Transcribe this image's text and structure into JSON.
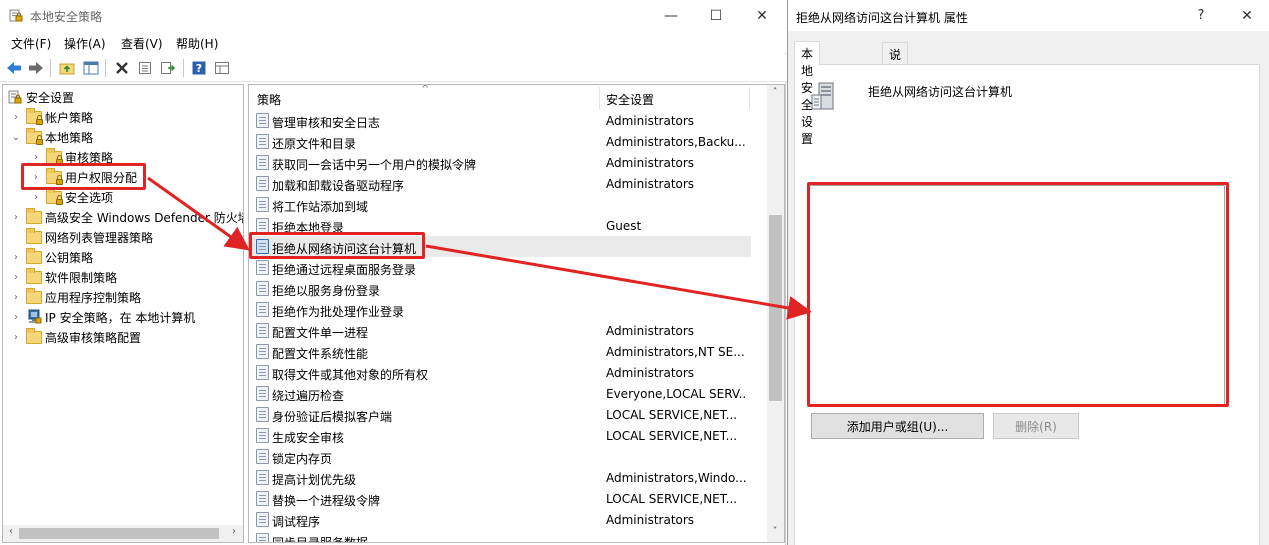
{
  "main_window": {
    "title": "本地安全策略",
    "controls": {
      "minimize": "—",
      "maximize": "☐",
      "close": "✕"
    }
  },
  "menu": [
    "文件(F)",
    "操作(A)",
    "查看(V)",
    "帮助(H)"
  ],
  "toolbar": {
    "icons": [
      "back-icon",
      "forward-icon",
      "up-folder-icon",
      "show-hide-tree-icon",
      "delete-icon",
      "properties-icon",
      "export-list-icon",
      "help-icon",
      "view-icon"
    ]
  },
  "tree": {
    "nodes": [
      {
        "label": "安全设置",
        "level": 0,
        "expander": "",
        "icon": "security-settings-icon"
      },
      {
        "label": "帐户策略",
        "level": 1,
        "expander": "›",
        "icon": "folder-lock-icon"
      },
      {
        "label": "本地策略",
        "level": 1,
        "expander": "⌄",
        "icon": "folder-lock-icon"
      },
      {
        "label": "审核策略",
        "level": 2,
        "expander": "›",
        "icon": "folder-lock-icon"
      },
      {
        "label": "用户权限分配",
        "level": 2,
        "expander": "›",
        "icon": "folder-lock-icon"
      },
      {
        "label": "安全选项",
        "level": 2,
        "expander": "›",
        "icon": "folder-lock-icon"
      },
      {
        "label": "高级安全 Windows Defender 防火墙",
        "level": 1,
        "expander": "›",
        "icon": "folder-icon"
      },
      {
        "label": "网络列表管理器策略",
        "level": 1,
        "expander": "",
        "icon": "folder-icon"
      },
      {
        "label": "公钥策略",
        "level": 1,
        "expander": "›",
        "icon": "folder-icon"
      },
      {
        "label": "软件限制策略",
        "level": 1,
        "expander": "›",
        "icon": "folder-icon"
      },
      {
        "label": "应用程序控制策略",
        "level": 1,
        "expander": "›",
        "icon": "folder-icon"
      },
      {
        "label": "IP 安全策略，在 本地计算机",
        "level": 1,
        "expander": "›",
        "icon": "ip-security-icon"
      },
      {
        "label": "高级审核策略配置",
        "level": 1,
        "expander": "›",
        "icon": "folder-icon"
      }
    ]
  },
  "list": {
    "columns": {
      "policy": "策略",
      "setting": "安全设置"
    },
    "rows": [
      {
        "name": "管理审核和安全日志",
        "value": "Administrators"
      },
      {
        "name": "还原文件和目录",
        "value": "Administrators,Backu..."
      },
      {
        "name": "获取同一会话中另一个用户的模拟令牌",
        "value": "Administrators"
      },
      {
        "name": "加载和卸载设备驱动程序",
        "value": "Administrators"
      },
      {
        "name": "将工作站添加到域",
        "value": ""
      },
      {
        "name": "拒绝本地登录",
        "value": "Guest"
      },
      {
        "name": "拒绝从网络访问这台计算机",
        "value": ""
      },
      {
        "name": "拒绝通过远程桌面服务登录",
        "value": ""
      },
      {
        "name": "拒绝以服务身份登录",
        "value": ""
      },
      {
        "name": "拒绝作为批处理作业登录",
        "value": ""
      },
      {
        "name": "配置文件单一进程",
        "value": "Administrators"
      },
      {
        "name": "配置文件系统性能",
        "value": "Administrators,NT SE..."
      },
      {
        "name": "取得文件或其他对象的所有权",
        "value": "Administrators"
      },
      {
        "name": "绕过遍历检查",
        "value": "Everyone,LOCAL SERV..."
      },
      {
        "name": "身份验证后模拟客户端",
        "value": "LOCAL SERVICE,NET..."
      },
      {
        "name": "生成安全审核",
        "value": "LOCAL SERVICE,NET..."
      },
      {
        "name": "锁定内存页",
        "value": ""
      },
      {
        "name": "提高计划优先级",
        "value": "Administrators,Windo..."
      },
      {
        "name": "替换一个进程级令牌",
        "value": "LOCAL SERVICE,NET..."
      },
      {
        "name": "调试程序",
        "value": "Administrators"
      },
      {
        "name": "同步目录服务数据",
        "value": ""
      }
    ],
    "selected_index": 6
  },
  "dialog": {
    "title": "拒绝从网络访问这台计算机 属性",
    "controls": {
      "help": "?",
      "close": "✕"
    },
    "tabs": [
      "本地安全设置",
      "说明"
    ],
    "policy_name": "拒绝从网络访问这台计算机",
    "add_button": "添加用户或组(U)...",
    "remove_button": "删除(R)",
    "users": []
  },
  "annotation_color": "#e02424"
}
